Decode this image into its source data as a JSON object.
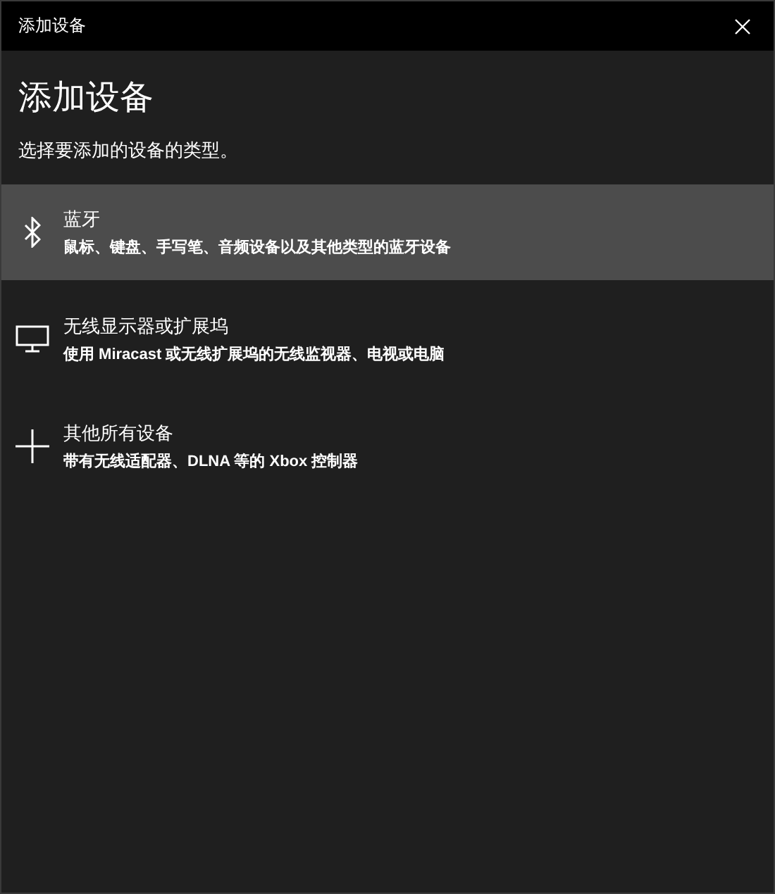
{
  "window": {
    "title": "添加设备"
  },
  "heading": "添加设备",
  "subtitle": "选择要添加的设备的类型。",
  "devices": [
    {
      "kind": "bluetooth",
      "name": "蓝牙",
      "description": "鼠标、键盘、手写笔、音频设备以及其他类型的蓝牙设备",
      "selected": true
    },
    {
      "kind": "display",
      "name": "无线显示器或扩展坞",
      "description": "使用 Miracast 或无线扩展坞的无线监视器、电视或电脑",
      "selected": false
    },
    {
      "kind": "other",
      "name": "其他所有设备",
      "description": "带有无线适配器、DLNA 等的 Xbox 控制器",
      "selected": false
    }
  ]
}
